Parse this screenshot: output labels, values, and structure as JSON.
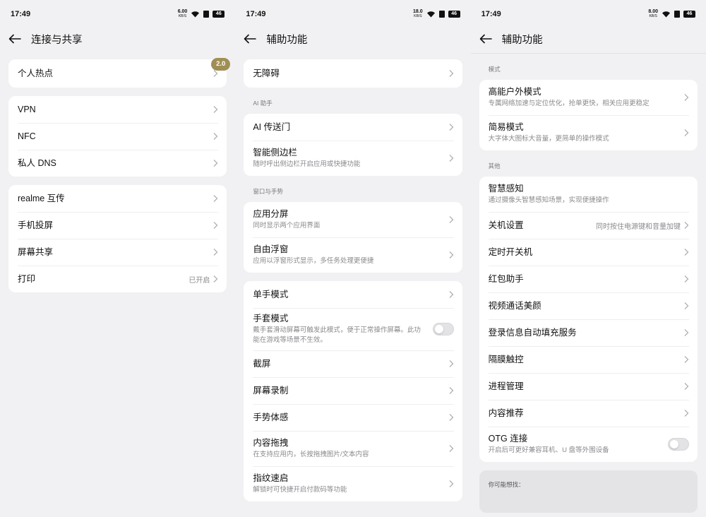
{
  "status": {
    "time": "17:49"
  },
  "screen1": {
    "status_speed": "6.00",
    "status_unit": "KB/S",
    "battery": "46",
    "title": "连接与共享",
    "hotspot": {
      "label": "个人热点",
      "badge": "2.0"
    },
    "group2": [
      "VPN",
      "NFC",
      "私人 DNS"
    ],
    "group3": {
      "items": [
        "realme 互传",
        "手机投屏",
        "屏幕共享"
      ],
      "print_label": "打印",
      "print_value": "已开启"
    }
  },
  "screen2": {
    "status_speed": "18.0",
    "status_unit": "KB/S",
    "battery": "46",
    "title": "辅助功能",
    "accessibility": "无障碍",
    "ai_section": "AI 助手",
    "ai_portal": "AI 传送门",
    "sidebar_title": "智能侧边栏",
    "sidebar_sub": "随时呼出侧边栏开启应用或快捷功能",
    "window_section": "窗口与手势",
    "split_title": "应用分屏",
    "split_sub": "同时显示两个应用界面",
    "float_title": "自由浮窗",
    "float_sub": "应用以浮窗形式显示，多任务处理更便捷",
    "onehand": "单手模式",
    "glove_title": "手套模式",
    "glove_sub": "戴手套滑动屏幕可触发此模式，便于正常操作屏幕。此功能在游戏等场景不生效。",
    "screenshot": "截屏",
    "recording": "屏幕录制",
    "gesture": "手势体感",
    "drag_title": "内容拖拽",
    "drag_sub": "在支持应用内，长按拖拽图片/文本内容",
    "finger_title": "指纹速启",
    "finger_sub": "解锁时可快捷开启付款码等功能"
  },
  "screen3": {
    "status_speed": "8.00",
    "status_unit": "KB/S",
    "battery": "46",
    "title": "辅助功能",
    "mode_section": "模式",
    "outdoor_title": "高能户外模式",
    "outdoor_sub": "专属网络加速与定位优化，抢单更快，相关应用更稳定",
    "simple_title": "简易模式",
    "simple_sub": "大字体大图标大音量，更简单的操作模式",
    "other_section": "其他",
    "smart_title": "智慧感知",
    "smart_sub": "通过摄像头智慧感知场景，实现便捷操作",
    "shutdown_title": "关机设置",
    "shutdown_value": "同时按住电源键和音量加键",
    "items": [
      "定时开关机",
      "红包助手",
      "视频通话美颜",
      "登录信息自动填充服务",
      "隔膜触控",
      "进程管理",
      "内容推荐"
    ],
    "otg_title": "OTG 连接",
    "otg_sub": "开启后可更好兼容耳机、U 盘等外围设备",
    "hint": "你可能想找："
  },
  "icons": {
    "back": "arrow-left-icon",
    "chevron": "chevron-right-icon",
    "wifi": "wifi-icon",
    "battery": "battery-icon"
  },
  "colors": {
    "badge": "#a08f55",
    "background": "#f1f1f3",
    "card": "#ffffff"
  }
}
